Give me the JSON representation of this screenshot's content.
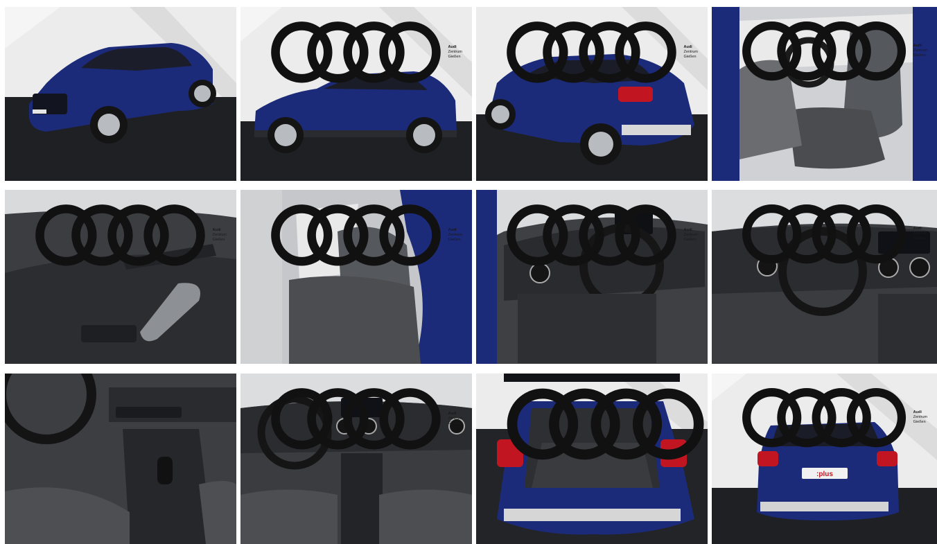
{
  "gallery": {
    "brand": {
      "name": "Audi",
      "dealer": "Zentrum Gießen"
    },
    "tiles": [
      {
        "subject": "exterior-front-three-quarter",
        "watermark": false,
        "bg": "studio"
      },
      {
        "subject": "exterior-side",
        "watermark": true,
        "bg": "studio"
      },
      {
        "subject": "exterior-rear-three-quarter",
        "watermark": true,
        "bg": "studio"
      },
      {
        "subject": "interior-front-seat",
        "watermark": true,
        "bg": "interior"
      },
      {
        "subject": "interior-door-panel",
        "watermark": true,
        "bg": "interior"
      },
      {
        "subject": "interior-rear-seat",
        "watermark": true,
        "bg": "interior"
      },
      {
        "subject": "interior-cockpit-side",
        "watermark": true,
        "bg": "interior"
      },
      {
        "subject": "interior-dashboard",
        "watermark": true,
        "bg": "interior"
      },
      {
        "subject": "interior-center-console",
        "watermark": false,
        "bg": "interior"
      },
      {
        "subject": "interior-dashboard-wide",
        "watermark": true,
        "bg": "interior"
      },
      {
        "subject": "trunk-open",
        "watermark": true,
        "bg": "studio"
      },
      {
        "subject": "exterior-rear",
        "watermark": true,
        "bg": "studio",
        "badge": ":plus"
      }
    ],
    "colors": {
      "paint": "#1c2a7a",
      "studio_light": "#eeeeee",
      "floor": "#1e1f23",
      "interior": "#3a3c40"
    }
  }
}
